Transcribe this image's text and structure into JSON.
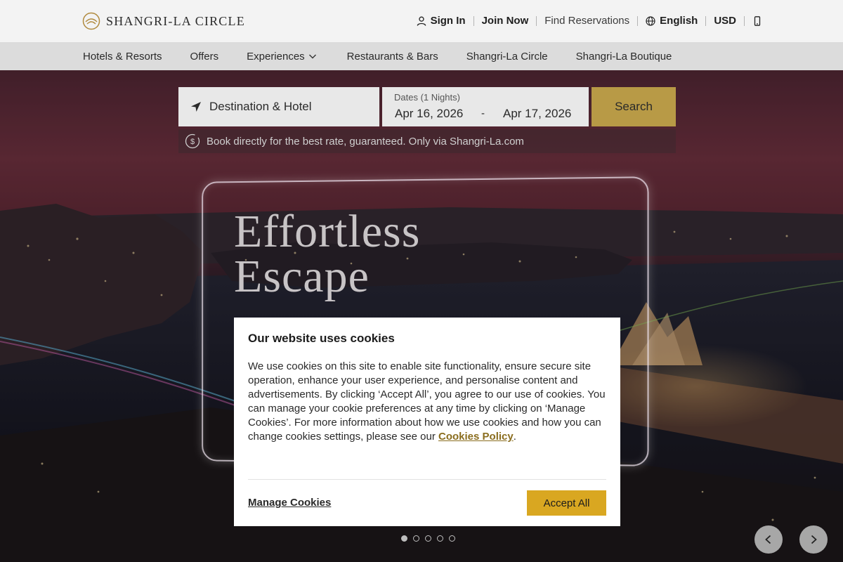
{
  "header": {
    "logo_text": "SHANGRI-LA CIRCLE",
    "utility": {
      "sign_in": "Sign In",
      "join_now": "Join Now",
      "find_reservations": "Find Reservations",
      "language": "English",
      "currency": "USD"
    },
    "nav": {
      "hotels": "Hotels & Resorts",
      "offers": "Offers",
      "experiences": "Experiences",
      "restaurants": "Restaurants & Bars",
      "circle": "Shangri-La Circle",
      "boutique": "Shangri-La Boutique"
    }
  },
  "search": {
    "destination_placeholder": "Destination & Hotel",
    "dates_label": "Dates (1 Nights)",
    "check_in": "Apr 16, 2026",
    "dash": "-",
    "check_out": "Apr 17, 2026",
    "search_label": "Search",
    "rate_note": "Book directly for the best rate, guaranteed. Only via Shangri-La.com"
  },
  "hero": {
    "headline_line1": "Effortless",
    "headline_line2": "Escape",
    "slide_count": 5,
    "active_slide": 1
  },
  "cookie": {
    "title": "Our website uses cookies",
    "body": "We use cookies on this site to enable site functionality, ensure secure site operation, enhance your user experience, and personalise content and advertisements. By clicking ‘Accept All’, you agree to our use of cookies. You can manage your cookie preferences at any time by clicking on ‘Manage Cookies’. For more information about how we use cookies and how you can change cookies settings, please see our ",
    "policy_link": "Cookies Policy",
    "period": ".",
    "manage_label": "Manage Cookies",
    "accept_label": "Accept All"
  },
  "colors": {
    "accent_gold": "#b89a46",
    "accept_gold": "#d9a721",
    "policy_link": "#8a6d1e"
  },
  "icons": {
    "user": "user-icon",
    "globe": "globe-icon",
    "phone": "mobile-phone-icon",
    "locate": "location-arrow-icon",
    "rate": "dollar-circle-icon",
    "chevron": "chevron-down-icon",
    "prev": "chevron-left-icon",
    "next": "chevron-right-icon"
  }
}
